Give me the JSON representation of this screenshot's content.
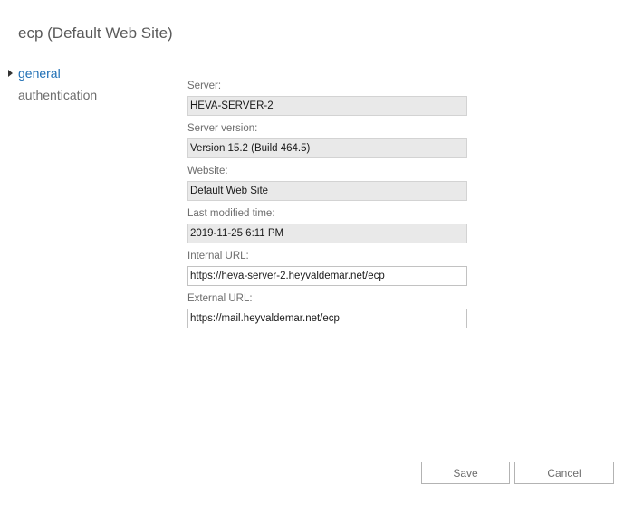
{
  "window": {
    "title": "ecp (Default Web Site)"
  },
  "nav": {
    "items": [
      {
        "label": "general",
        "active": true
      },
      {
        "label": "authentication",
        "active": false
      }
    ]
  },
  "form": {
    "server": {
      "label": "Server:",
      "value": "HEVA-SERVER-2"
    },
    "server_version": {
      "label": "Server version:",
      "value": "Version 15.2 (Build 464.5)"
    },
    "website": {
      "label": "Website:",
      "value": "Default Web Site"
    },
    "last_modified": {
      "label": "Last modified time:",
      "value": "2019-11-25 6:11 PM"
    },
    "internal_url": {
      "label": "Internal URL:",
      "value": "https://heva-server-2.heyvaldemar.net/ecp"
    },
    "external_url": {
      "label": "External URL:",
      "value": "https://mail.heyvaldemar.net/ecp"
    }
  },
  "buttons": {
    "save": "Save",
    "cancel": "Cancel"
  },
  "colors": {
    "nav_active": "#1f6fb5",
    "readonly_background": "#e9e9e9"
  },
  "icons": {
    "nav_selected": "triangle-right-icon"
  }
}
